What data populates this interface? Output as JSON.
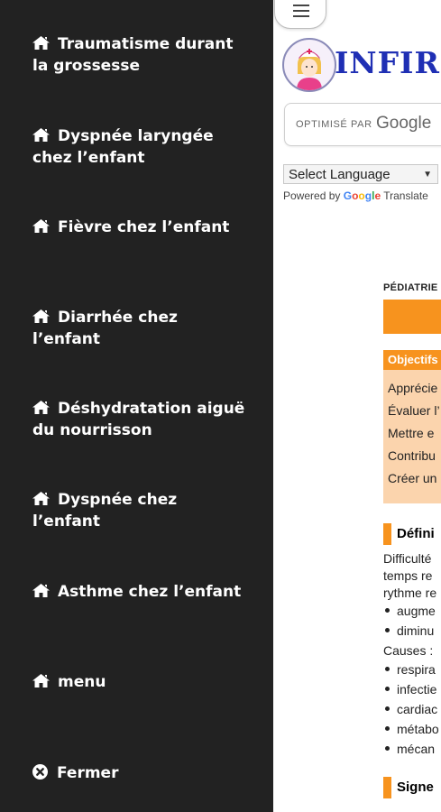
{
  "sidebar": {
    "items": [
      {
        "label_line1": "Traumatisme durant",
        "label_line2": "la grossesse",
        "icon": "home-icon"
      },
      {
        "label_line1": "Dyspnée laryngée",
        "label_line2": "chez l’enfant",
        "icon": "home-icon"
      },
      {
        "label_line1": "Fièvre chez l’enfant",
        "label_line2": "",
        "icon": "home-icon"
      },
      {
        "label_line1": "Diarrhée chez l’enfant",
        "label_line2": "",
        "icon": "home-icon"
      },
      {
        "label_line1": "Déshydratation aiguë",
        "label_line2": "du nourrisson",
        "icon": "home-icon"
      },
      {
        "label_line1": "Dyspnée chez l’enfant",
        "label_line2": "",
        "icon": "home-icon"
      },
      {
        "label_line1": "Asthme chez l’enfant",
        "label_line2": "",
        "icon": "home-icon"
      },
      {
        "label_line1": "menu",
        "label_line2": "",
        "icon": "home-icon"
      }
    ],
    "close": {
      "label": "Fermer",
      "icon": "close-circle-icon"
    }
  },
  "page": {
    "brand": "INFIRM",
    "search": {
      "optimise_label": "OPTIMISÉ PAR",
      "google_label": "Google"
    },
    "translate": {
      "select_value": "Select Language",
      "powered_by": "Powered by",
      "google": "Google",
      "translate": "Translate"
    },
    "category": "PÉDIATRIE",
    "objectives": {
      "heading": "Objectifs",
      "lines": [
        "Apprécie",
        "Évaluer l’",
        "Mettre e",
        "Contribu",
        "Créer un"
      ]
    },
    "definition": {
      "heading": "Défini",
      "lines": [
        "Difficulté",
        "temps re",
        "rythme re"
      ],
      "bullets1": [
        "augme",
        "diminu"
      ],
      "causes_label": "Causes :",
      "bullets2": [
        "respira",
        "infectie",
        "cardiac",
        "métabo",
        "mécan"
      ]
    },
    "signs_heading": "Signe"
  },
  "colors": {
    "sidebar_bg": "#222222",
    "accent_orange": "#f7931e",
    "light_orange": "#fbd4ad",
    "brand_blue": "#1f2fb4"
  }
}
